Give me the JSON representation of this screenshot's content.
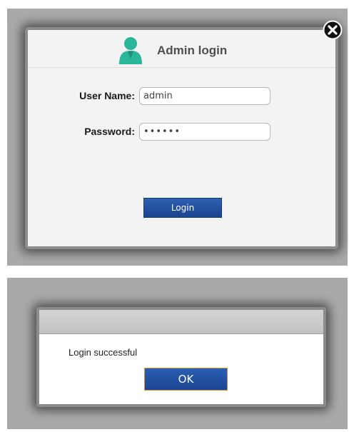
{
  "login_dialog": {
    "title": "Admin login",
    "username_label": "User Name:",
    "username_value": "admin",
    "password_label": "Password:",
    "password_value": "••••••",
    "login_button": "Login",
    "avatar_icon": "user-icon",
    "close_icon": "close-icon"
  },
  "message_dialog": {
    "title": "",
    "message": "Login successful",
    "ok_button": "OK"
  },
  "colors": {
    "backdrop": "#a9a9a9",
    "dialog_bg": "#f3f3f3",
    "button_blue": "#1f4c99",
    "avatar_teal": "#2bb59a",
    "ok_border": "#d9902f"
  }
}
